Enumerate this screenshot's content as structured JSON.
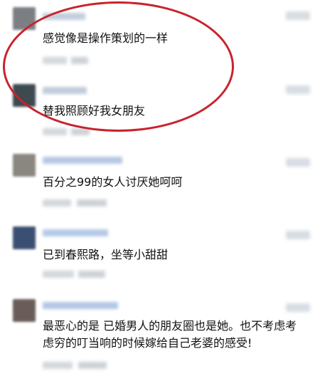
{
  "comments": [
    {
      "text": "感觉像是操作策划的一样",
      "avatar_color": "#7b7f83",
      "name_color": "#b8c6d8"
    },
    {
      "text": "替我照顾好我女朋友",
      "avatar_color": "#3d4a50",
      "name_color": "#b6c4d6"
    },
    {
      "text": "百分之99的女人讨厌她呵呵",
      "avatar_color": "#8a8680",
      "name_color": "#a9bfe0"
    },
    {
      "text": "已到春熙路，坐等小甜甜",
      "avatar_color": "#3b4f72",
      "name_color": "#a8c0e2"
    },
    {
      "text": "最恶心的是 已婚男人的朋友圈也是她。也不考虑考虑穷的叮当响的时候嫁给自己老婆的感受!",
      "avatar_color": "#6a5c58",
      "name_color": "#a5bde0"
    }
  ],
  "highlight_color": "#c8232c"
}
